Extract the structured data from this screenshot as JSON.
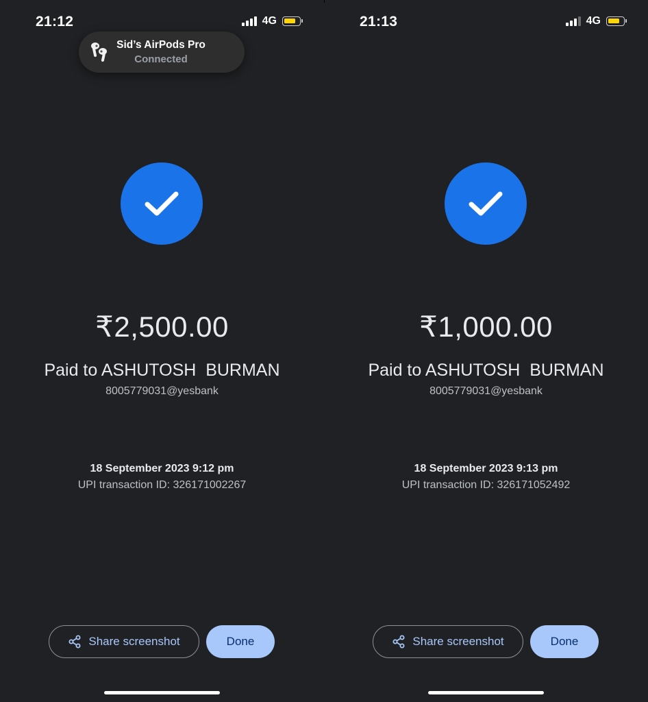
{
  "screens": [
    {
      "status_bar": {
        "time": "21:12",
        "network": "4G",
        "signal_bars": 4
      },
      "notification": {
        "title": "Sid’s AirPods Pro",
        "subtitle": "Connected",
        "icon": "airpods-icon"
      },
      "success_icon": "checkmark-icon",
      "amount": "₹2,500.00",
      "paid_to": "Paid to ASHUTOSH  BURMAN",
      "upi_id": "8005779031@yesbank",
      "datetime": "18 September 2023 9:12 pm",
      "transaction_id": "UPI transaction ID: 326171002267",
      "share_label": "Share screenshot",
      "done_label": "Done"
    },
    {
      "status_bar": {
        "time": "21:13",
        "network": "4G",
        "signal_bars": 3
      },
      "success_icon": "checkmark-icon",
      "amount": "₹1,000.00",
      "paid_to": "Paid to ASHUTOSH  BURMAN",
      "upi_id": "8005779031@yesbank",
      "datetime": "18 September 2023 9:13 pm",
      "transaction_id": "UPI transaction ID: 326171052492",
      "share_label": "Share screenshot",
      "done_label": "Done"
    }
  ],
  "colors": {
    "background": "#202124",
    "success_blue": "#1a73e8",
    "button_blue": "#a8c7fa",
    "button_text_dark": "#062e6f",
    "battery_yellow": "#ffd60a"
  }
}
